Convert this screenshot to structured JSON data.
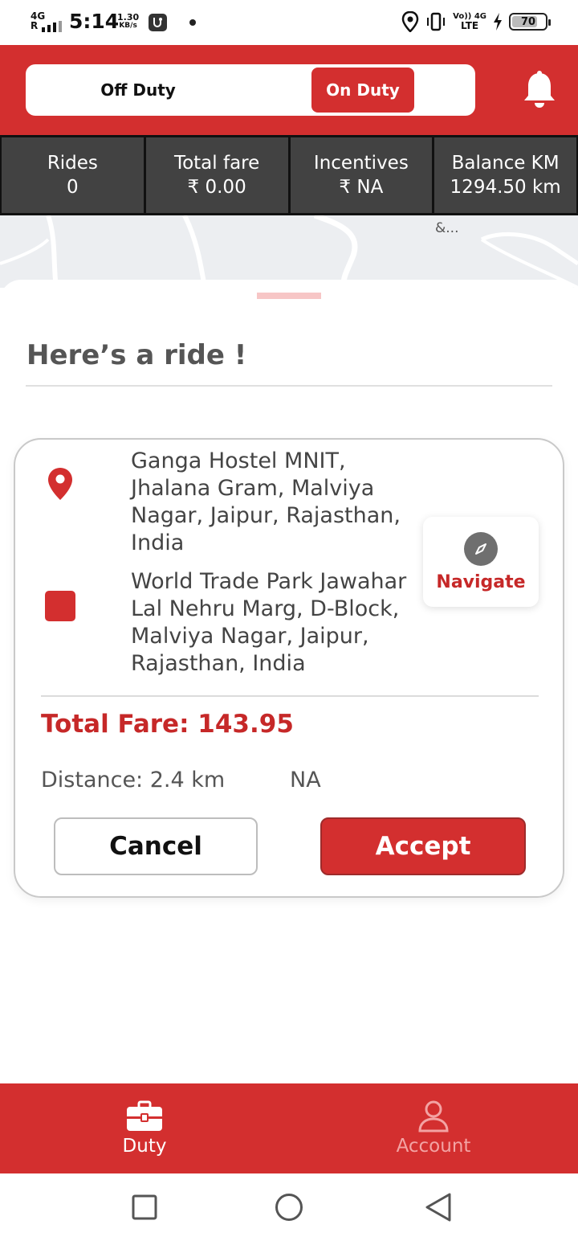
{
  "status_bar": {
    "network": "4G",
    "signal_label": "R",
    "time": "5:14",
    "speed_value": "1.30",
    "speed_unit": "KB/s",
    "volte_top": "Vo)) 4G",
    "volte_bottom": "LTE",
    "battery": "70",
    "icons": [
      "location-icon",
      "vibrate-icon",
      "charging-icon",
      "usb-debug-icon"
    ]
  },
  "header": {
    "off_duty_label": "Off Duty",
    "on_duty_label": "On Duty",
    "active_state": "On Duty",
    "bell_icon": "bell-icon",
    "brand_color": "#d32f2f"
  },
  "stats": [
    {
      "label": "Rides",
      "value": "0"
    },
    {
      "label": "Total fare",
      "value": "₹ 0.00"
    },
    {
      "label": "Incentives",
      "value": "₹ NA"
    },
    {
      "label": "Balance KM",
      "value": "1294.50 km"
    }
  ],
  "map": {
    "label": "&..."
  },
  "ride_sheet": {
    "title": "Here’s a ride !",
    "pickup_address": "Ganga Hostel MNIT, Jhalana Gram, Malviya Nagar, Jaipur, Rajasthan, India",
    "drop_address": "World Trade Park Jawahar Lal Nehru Marg, D-Block, Malviya Nagar, Jaipur, Rajasthan, India",
    "navigate_label": "Navigate",
    "total_fare": "Total Fare: 143.95",
    "distance": "Distance: 2.4 km",
    "eta": "NA",
    "cancel_label": "Cancel",
    "accept_label": "Accept"
  },
  "bottom_nav": {
    "items": [
      {
        "label": "Duty",
        "icon": "briefcase-icon",
        "active": true
      },
      {
        "label": "Account",
        "icon": "person-icon",
        "active": false
      }
    ]
  },
  "system_nav": [
    "recents-icon",
    "home-icon",
    "back-icon"
  ]
}
